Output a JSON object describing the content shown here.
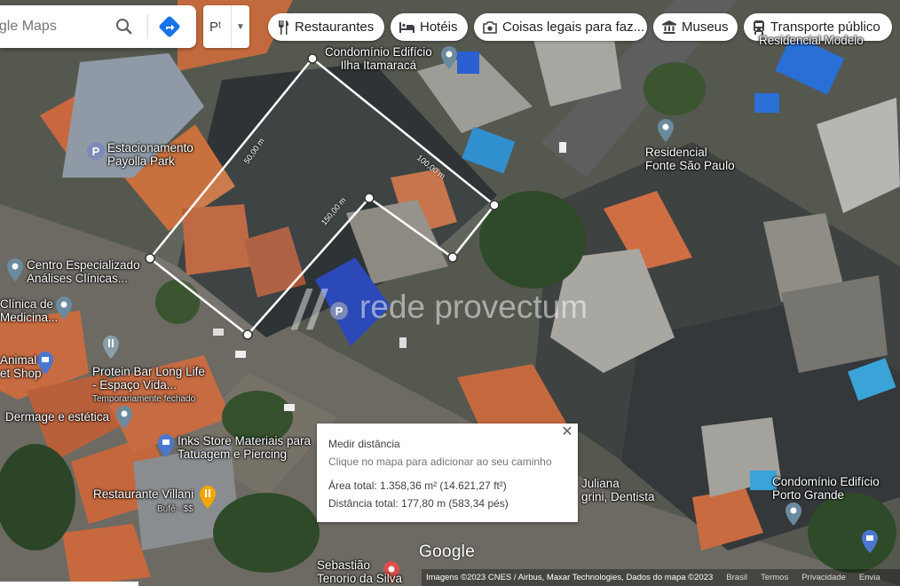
{
  "search": {
    "placeholder": "ogle Maps"
  },
  "layer": {
    "label": "Pᵗ"
  },
  "chips": [
    {
      "icon": "restaurant-icon",
      "label": "Restaurantes"
    },
    {
      "icon": "hotel-icon",
      "label": "Hotéis"
    },
    {
      "icon": "camera-icon",
      "label": "Coisas legais para faz..."
    },
    {
      "icon": "museum-icon",
      "label": "Museus"
    },
    {
      "icon": "transit-icon",
      "label": "Transporte público"
    }
  ],
  "places": [
    {
      "name": "Condomínio Edifício\nIlha Itamaracá"
    },
    {
      "name": "Residencial Modelo"
    },
    {
      "name": "Estacionamento\nPayolla Park"
    },
    {
      "name": "Residencial\nFonte São Paulo"
    },
    {
      "name": "Centro Especializado\nAnálises Clínicas..."
    },
    {
      "name": "Clínica de\nMedicina..."
    },
    {
      "name": "Animal\net Shop"
    },
    {
      "name": "Protein Bar Long Life\n- Espaço Vida..."
    },
    {
      "name": "Temporariamente fechado"
    },
    {
      "name": "Dermage e estética"
    },
    {
      "name": "Inks Store Materiais para\nTatuagem e Piercing"
    },
    {
      "name": "Restaurante Villani"
    },
    {
      "name": "Bufê · $$"
    },
    {
      "name": "Juliana\ngrini, Dentista"
    },
    {
      "name": "Condomínio Edifício\nPorto Grande"
    },
    {
      "name": "Sebastião\nTenorio da Silva"
    }
  ],
  "measure_labels": {
    "a": "50,00 m",
    "b": "100,00 m",
    "c": "150,00 m"
  },
  "watermark": "rede provectum",
  "measure_card": {
    "title": "Medir distância",
    "subtitle": "Clique no mapa para adicionar ao seu caminho",
    "area": "Área total: 1.358,36 m² (14.621,27 ft²)",
    "distance": "Distância total: 177,80 m (583,34 pés)"
  },
  "google_logo": "Google",
  "footer": {
    "imagery": "Imagens ©2023 CNES / Airbus, Maxar Technologies, Dados do mapa ©2023",
    "country": "Brasil",
    "terms": "Termos",
    "privacy": "Privacidade",
    "feedback": "Envia"
  }
}
